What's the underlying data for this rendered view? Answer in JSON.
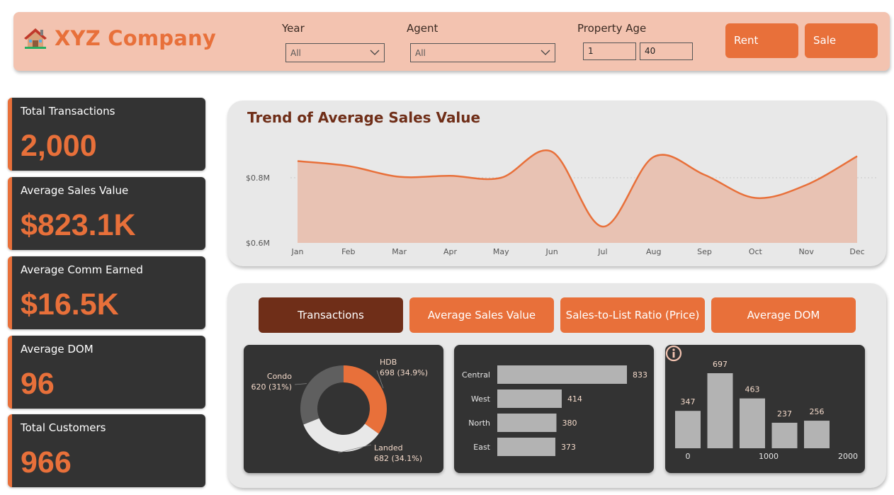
{
  "header": {
    "title": "XYZ Company",
    "logo_icon": "house-icon",
    "filters": {
      "year": {
        "label": "Year",
        "value": "All"
      },
      "agent": {
        "label": "Agent",
        "value": "All"
      },
      "property_age": {
        "label": "Property Age",
        "min": "1",
        "max": "40"
      }
    },
    "buttons": {
      "rent": "Rent",
      "sale": "Sale"
    }
  },
  "kpis": [
    {
      "label": "Total Transactions",
      "value": "2,000"
    },
    {
      "label": "Average Sales Value",
      "value": "$823.1K"
    },
    {
      "label": "Average Comm Earned",
      "value": "$16.5K"
    },
    {
      "label": "Average DOM",
      "value": "96"
    },
    {
      "label": "Total Customers",
      "value": "966"
    }
  ],
  "tabs": [
    "Transactions",
    "Average Sales Value",
    "Sales-to-List Ratio (Price)",
    "Average DOM"
  ],
  "active_tab": "Transactions",
  "colors": {
    "accent": "#e8703a",
    "dark": "#6f2e18",
    "card": "#333333",
    "header_bg": "#f3c3b0"
  },
  "chart_data": [
    {
      "type": "area",
      "title": "Trend of Average Sales Value",
      "x": [
        "Jan",
        "Feb",
        "Mar",
        "Apr",
        "May",
        "Jun",
        "Jul",
        "Aug",
        "Sep",
        "Oct",
        "Nov",
        "Dec"
      ],
      "values": [
        0.851,
        0.836,
        0.803,
        0.806,
        0.8,
        0.88,
        0.65,
        0.864,
        0.809,
        0.738,
        0.778,
        0.866
      ],
      "yticks": [
        {
          "value": 0.6,
          "label": "$0.6M"
        },
        {
          "value": 0.8,
          "label": "$0.8M"
        }
      ],
      "ylim": [
        0.6,
        0.95
      ],
      "grid": true
    },
    {
      "type": "pie",
      "variant": "donut",
      "slices": [
        {
          "name": "HDB",
          "value": 698,
          "label": "698 (34.9%)",
          "color": "#e8703a"
        },
        {
          "name": "Landed",
          "value": 682,
          "label": "682 (34.1%)",
          "color": "#e8e8e8"
        },
        {
          "name": "Condo",
          "value": 620,
          "label": "620 (31%)",
          "color": "#5f5f5f"
        }
      ]
    },
    {
      "type": "bar",
      "orientation": "horizontal",
      "categories": [
        "Central",
        "West",
        "North",
        "East"
      ],
      "values": [
        833,
        414,
        380,
        373
      ],
      "xlim": [
        0,
        833
      ]
    },
    {
      "type": "bar",
      "variant": "histogram",
      "values": [
        347,
        697,
        463,
        237,
        256
      ],
      "xticks": [
        "0",
        "1000",
        "2000"
      ],
      "ylim": [
        0,
        697
      ]
    }
  ]
}
